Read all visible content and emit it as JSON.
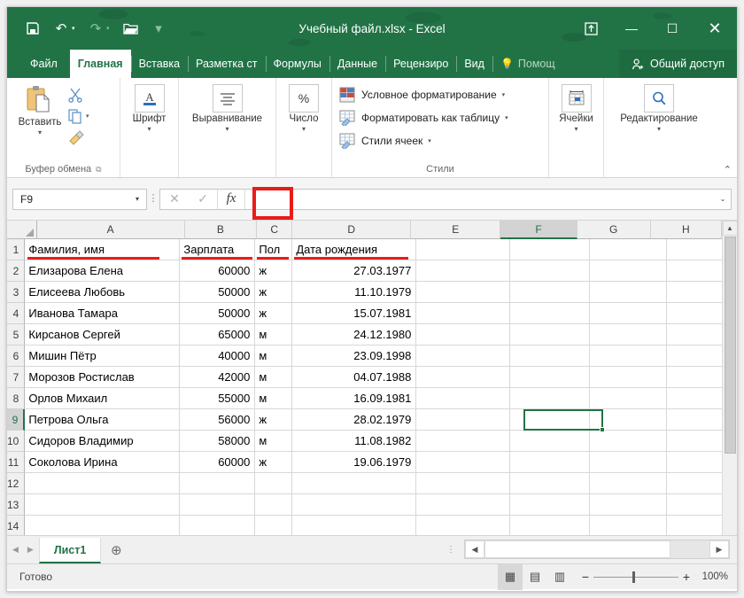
{
  "window": {
    "title": "Учебный файл.xlsx - Excel",
    "quick_access": [
      {
        "name": "save-icon",
        "glyph": "💾"
      },
      {
        "name": "undo-icon",
        "glyph": "↶"
      },
      {
        "name": "redo-icon",
        "glyph": "↷"
      },
      {
        "name": "open-icon",
        "glyph": "📂"
      },
      {
        "name": "customize-qat-icon",
        "glyph": "▾"
      }
    ],
    "controls": {
      "ribbon_display": "⤒",
      "minimize": "—",
      "maximize": "☐",
      "close": "✕"
    }
  },
  "ribbon": {
    "tabs": [
      {
        "label": "Файл",
        "active": false
      },
      {
        "label": "Главная",
        "active": true
      },
      {
        "label": "Вставка",
        "active": false
      },
      {
        "label": "Разметка ст",
        "active": false
      },
      {
        "label": "Формулы",
        "active": false
      },
      {
        "label": "Данные",
        "active": false
      },
      {
        "label": "Рецензиро",
        "active": false
      },
      {
        "label": "Вид",
        "active": false
      }
    ],
    "tell_me": "Помощ",
    "share": "Общий доступ",
    "groups": {
      "clipboard": {
        "label": "Буфер обмена",
        "paste": "Вставить",
        "cut": "Вырезать",
        "copy": "Копировать",
        "format_painter": "Формат по образцу"
      },
      "font": {
        "label": "Шрифт"
      },
      "alignment": {
        "label": "Выравнивание"
      },
      "number": {
        "label": "Число"
      },
      "styles": {
        "label": "Стили",
        "items": [
          "Условное форматирование",
          "Форматировать как таблицу",
          "Стили ячеек"
        ]
      },
      "cells": {
        "label": "Ячейки"
      },
      "editing": {
        "label": "Редактирование"
      }
    }
  },
  "formula_bar": {
    "name_box": "F9",
    "cancel_icon": "✕",
    "enter_icon": "✓",
    "fx_label": "fx",
    "value": "",
    "expand_icon": "⌄",
    "highlight_color": "#e81d19"
  },
  "sheet": {
    "columns": [
      "A",
      "B",
      "C",
      "D",
      "E",
      "F",
      "G",
      "H"
    ],
    "selected_column": "F",
    "selected_row": 9,
    "selected_cell": "F9",
    "rows": [
      {
        "n": 1,
        "a": "Фамилия, имя",
        "b": "Зарплата",
        "c": "Пол",
        "d": "Дата рождения",
        "header": true
      },
      {
        "n": 2,
        "a": "Елизарова Елена",
        "b": "60000",
        "c": "ж",
        "d": "27.03.1977"
      },
      {
        "n": 3,
        "a": "Елисеева Любовь",
        "b": "50000",
        "c": "ж",
        "d": "11.10.1979"
      },
      {
        "n": 4,
        "a": "Иванова Тамара",
        "b": "50000",
        "c": "ж",
        "d": "15.07.1981"
      },
      {
        "n": 5,
        "a": "Кирсанов Сергей",
        "b": "65000",
        "c": "м",
        "d": "24.12.1980"
      },
      {
        "n": 6,
        "a": "Мишин Пётр",
        "b": "40000",
        "c": "м",
        "d": "23.09.1998"
      },
      {
        "n": 7,
        "a": "Морозов Ростислав",
        "b": "42000",
        "c": "м",
        "d": "04.07.1988"
      },
      {
        "n": 8,
        "a": "Орлов Михаил",
        "b": "55000",
        "c": "м",
        "d": "16.09.1981"
      },
      {
        "n": 9,
        "a": "Петрова Ольга",
        "b": "56000",
        "c": "ж",
        "d": "28.02.1979"
      },
      {
        "n": 10,
        "a": "Сидоров Владимир",
        "b": "58000",
        "c": "м",
        "d": "11.08.1982"
      },
      {
        "n": 11,
        "a": "Соколова Ирина",
        "b": "60000",
        "c": "ж",
        "d": "19.06.1979"
      },
      {
        "n": 12,
        "a": "",
        "b": "",
        "c": "",
        "d": ""
      },
      {
        "n": 13,
        "a": "",
        "b": "",
        "c": "",
        "d": ""
      },
      {
        "n": 14,
        "a": "",
        "b": "",
        "c": "",
        "d": ""
      }
    ]
  },
  "sheet_tabs": {
    "tabs": [
      "Лист1"
    ],
    "active": "Лист1",
    "add_label": "⊕",
    "prev_icon": "◀",
    "next_icon": "▶"
  },
  "status_bar": {
    "status": "Готово",
    "views": [
      {
        "name": "normal-view",
        "glyph": "▦",
        "active": true
      },
      {
        "name": "page-layout-view",
        "glyph": "▤",
        "active": false
      },
      {
        "name": "page-break-view",
        "glyph": "▥",
        "active": false
      }
    ],
    "zoom_out": "−",
    "zoom_in": "+",
    "zoom_level": "100%"
  },
  "colors": {
    "excel_green": "#217346",
    "highlight_red": "#e81d19"
  }
}
